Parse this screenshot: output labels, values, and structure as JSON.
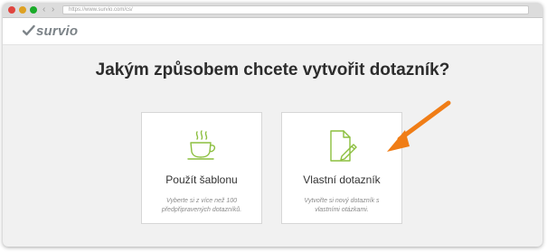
{
  "browser": {
    "url": "https://www.survio.com/cs/",
    "back_label": "‹",
    "forward_label": "›"
  },
  "header": {
    "logo_text": "survio"
  },
  "main": {
    "headline": "Jakým způsobem chcete vytvořit dotazník?",
    "cards": [
      {
        "title": "Použít šablonu",
        "description": "Vyberte si z více než 100 předpřipravených dotazníků.",
        "icon": "coffee-cup-icon"
      },
      {
        "title": "Vlastní dotazník",
        "description": "Vytvořte si nový dotazník s vlastními otázkami.",
        "icon": "document-pencil-icon"
      }
    ]
  },
  "colors": {
    "accent_green": "#8cbf3f",
    "arrow_orange": "#f07d16",
    "headline": "#2c2c2c"
  }
}
